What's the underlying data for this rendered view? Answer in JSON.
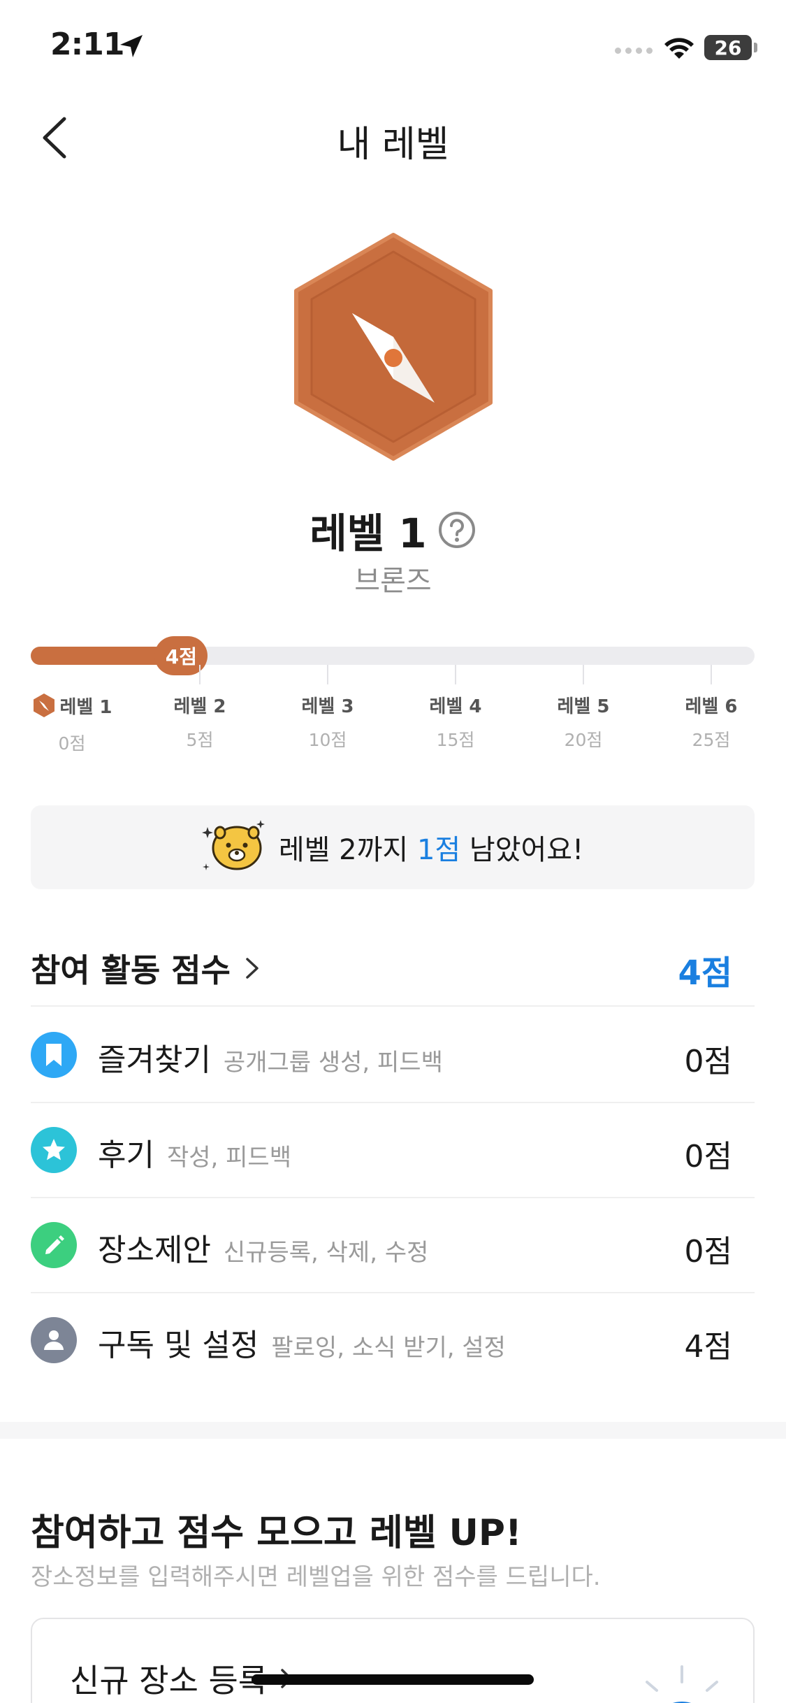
{
  "status_bar": {
    "time": "2:11",
    "battery": "26"
  },
  "nav": {
    "title": "내 레벨"
  },
  "level": {
    "title": "레벨 1",
    "tier": "브론즈"
  },
  "progress": {
    "current_points_label": "4점",
    "current_points": 4,
    "max_points": 25,
    "stops": [
      {
        "label": "레벨 1",
        "points": "0점"
      },
      {
        "label": "레벨 2",
        "points": "5점"
      },
      {
        "label": "레벨 3",
        "points": "10점"
      },
      {
        "label": "레벨 4",
        "points": "15점"
      },
      {
        "label": "레벨 5",
        "points": "20점"
      },
      {
        "label": "레벨 6",
        "points": "25점"
      }
    ]
  },
  "remaining": {
    "prefix": "레벨 2까지 ",
    "highlight": "1점",
    "suffix": " 남았어요!"
  },
  "activity": {
    "title": "참여 활동 점수",
    "total": "4점",
    "rows": [
      {
        "icon": "bookmark-icon",
        "color": "#2ea8f5",
        "title": "즐겨찾기",
        "sub": "공개그룹 생성, 피드백",
        "points": "0점"
      },
      {
        "icon": "star-icon",
        "color": "#2cc3d8",
        "title": "후기",
        "sub": "작성, 피드백",
        "points": "0점"
      },
      {
        "icon": "pencil-icon",
        "color": "#3ccf7f",
        "title": "장소제안",
        "sub": "신규등록, 삭제, 수정",
        "points": "0점"
      },
      {
        "icon": "person-icon",
        "color": "#7d8596",
        "title": "구독 및 설정",
        "sub": "팔로잉, 소식 받기, 설정",
        "points": "4점"
      }
    ]
  },
  "promo": {
    "title": "참여하고 점수 모으고 레벨 UP!",
    "subtitle": "장소정보를 입력해주시면 레벨업을 위한 점수를 드립니다.",
    "card_label": "신규 장소 등록"
  },
  "colors": {
    "bronze": "#c96f40",
    "accent_blue": "#1a7fe0"
  }
}
